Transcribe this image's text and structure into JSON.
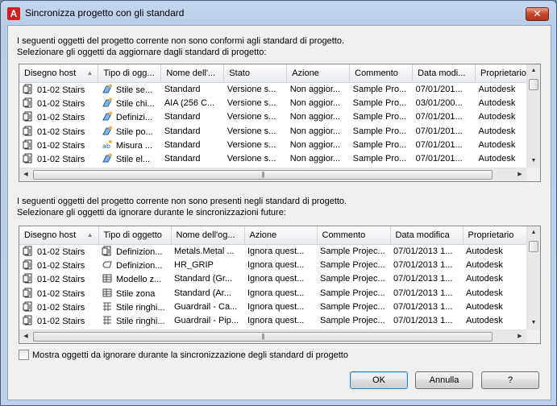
{
  "window": {
    "title": "Sincronizza progetto con gli standard",
    "app_icon_letter": "A",
    "close_label": "✕"
  },
  "top_section": {
    "intro_line1": "I seguenti oggetti del progetto corrente non sono conformi agli standard di progetto.",
    "intro_line2": "Selezionare gli oggetti da aggiornare dagli standard di progetto:",
    "columns": [
      "Disegno host",
      "Tipo di ogg...",
      "Nome dell'...",
      "Stato",
      "Azione",
      "Commento",
      "Data modi...",
      "Proprietario"
    ],
    "rows": [
      {
        "host": "01-02 Stairs",
        "type": "Stile se...",
        "name": "Standard",
        "state": "Versione s...",
        "action": "Non aggior...",
        "comment": "Sample Pro...",
        "date": "07/01/201...",
        "owner": "Autodesk",
        "icon": "stair-style-icon"
      },
      {
        "host": "01-02 Stairs",
        "type": "Stile chi...",
        "name": "AIA (256 C...",
        "state": "Versione s...",
        "action": "Non aggior...",
        "comment": "Sample Pro...",
        "date": "03/01/200...",
        "owner": "Autodesk",
        "icon": "key-style-icon"
      },
      {
        "host": "01-02 Stairs",
        "type": "Definizi...",
        "name": "Standard",
        "state": "Versione s...",
        "action": "Non aggior...",
        "comment": "Sample Pro...",
        "date": "07/01/201...",
        "owner": "Autodesk",
        "icon": "definition-icon"
      },
      {
        "host": "01-02 Stairs",
        "type": "Stile po...",
        "name": "Standard",
        "state": "Versione s...",
        "action": "Non aggior...",
        "comment": "Sample Pro...",
        "date": "07/01/201...",
        "owner": "Autodesk",
        "icon": "polygon-style-icon"
      },
      {
        "host": "01-02 Stairs",
        "type": "Misura ...",
        "name": "Standard",
        "state": "Versione s...",
        "action": "Non aggior...",
        "comment": "Sample Pro...",
        "date": "07/01/201...",
        "owner": "Autodesk",
        "icon": "dimension-icon"
      },
      {
        "host": "01-02 Stairs",
        "type": "Stile el...",
        "name": "Standard",
        "state": "Versione s...",
        "action": "Non aggior...",
        "comment": "Sample Pro...",
        "date": "07/01/201...",
        "owner": "Autodesk",
        "icon": "element-style-icon"
      }
    ]
  },
  "bottom_section": {
    "intro_line1": "I seguenti oggetti del progetto corrente non sono presenti negli standard di progetto.",
    "intro_line2": "Selezionare gli oggetti da ignorare durante le sincronizzazioni future:",
    "columns": [
      "Disegno host",
      "Tipo di oggetto",
      "Nome dell'og...",
      "Azione",
      "Commento",
      "Data modifica",
      "Proprietario"
    ],
    "rows": [
      {
        "host": "01-02 Stairs",
        "type": "Definizion...",
        "name": "Metals.Metal ...",
        "action": "Ignora quest...",
        "comment": "Sample Projec...",
        "date": "07/01/2013 1...",
        "owner": "Autodesk",
        "icon": "material-icon"
      },
      {
        "host": "01-02 Stairs",
        "type": "Definizion...",
        "name": "HR_GRIP",
        "action": "Ignora quest...",
        "comment": "Sample Projec...",
        "date": "07/01/2013 1...",
        "owner": "Autodesk",
        "icon": "profile-icon"
      },
      {
        "host": "01-02 Stairs",
        "type": "Modello z...",
        "name": "Standard (Gr...",
        "action": "Ignora quest...",
        "comment": "Sample Projec...",
        "date": "07/01/2013 1...",
        "owner": "Autodesk",
        "icon": "zone-template-icon"
      },
      {
        "host": "01-02 Stairs",
        "type": "Stile zona",
        "name": "Standard (Ar...",
        "action": "Ignora quest...",
        "comment": "Sample Projec...",
        "date": "07/01/2013 1...",
        "owner": "Autodesk",
        "icon": "zone-style-icon"
      },
      {
        "host": "01-02 Stairs",
        "type": "Stile ringhi...",
        "name": "Guardrail - Ca...",
        "action": "Ignora quest...",
        "comment": "Sample Projec...",
        "date": "07/01/2013 1...",
        "owner": "Autodesk",
        "icon": "railing-style-icon"
      },
      {
        "host": "01-02 Stairs",
        "type": "Stile ringhi...",
        "name": "Guardrail - Pip...",
        "action": "Ignora quest...",
        "comment": "Sample Projec...",
        "date": "07/01/2013 1...",
        "owner": "Autodesk",
        "icon": "railing-style-icon"
      }
    ]
  },
  "checkbox_label": "Mostra oggetti da ignorare durante la sincronizzazione degli standard di progetto",
  "checkbox_checked": false,
  "buttons": {
    "ok": "OK",
    "cancel": "Annulla",
    "help": "?"
  }
}
